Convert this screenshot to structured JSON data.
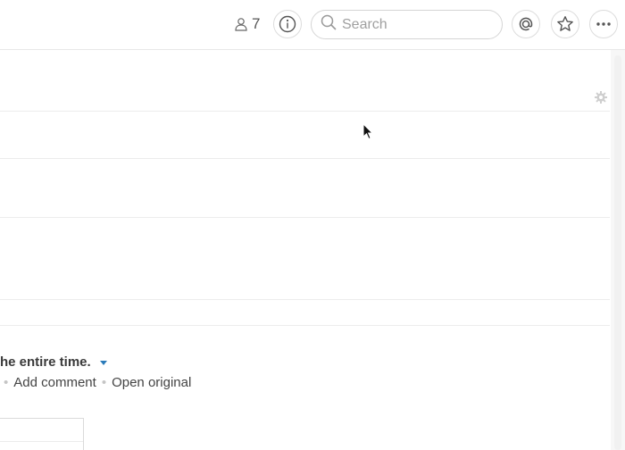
{
  "header": {
    "member_count": "7",
    "search": {
      "placeholder": "Search",
      "value": ""
    },
    "icons": [
      "member-icon",
      "info-icon",
      "search-icon",
      "mentions-icon",
      "star-icon",
      "more-icon"
    ]
  },
  "content": {
    "message_text": "he entire time.",
    "actions": {
      "separator": "•",
      "add_comment": "Add comment",
      "open_original": "Open original"
    }
  },
  "colors": {
    "caret": "#2b7bb9",
    "border": "#dcdcdc",
    "muted_text": "#616061"
  }
}
